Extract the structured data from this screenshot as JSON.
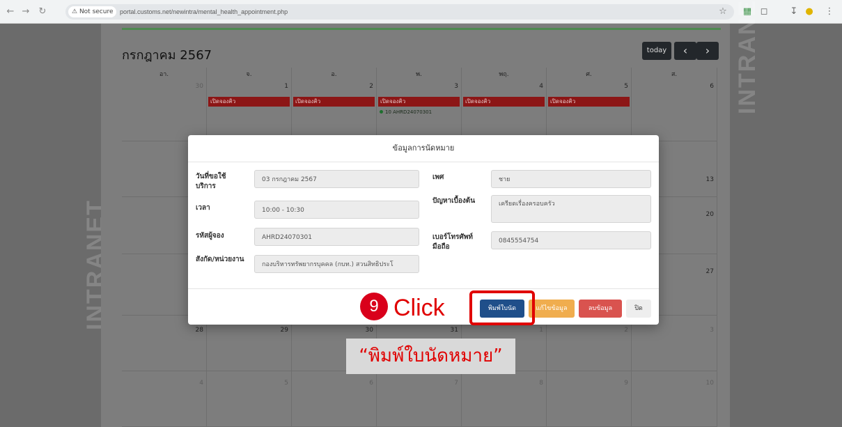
{
  "browser": {
    "security_label": "Not secure",
    "url": "portal.customs.net/newintra/mental_health_appointment.php"
  },
  "calendar": {
    "month_title": "กรกฎาคม 2567",
    "today_label": "today",
    "prev_label": "‹",
    "next_label": "›",
    "weekdays": [
      "อา.",
      "จ.",
      "อ.",
      "พ.",
      "พฤ.",
      "ศ.",
      "ส."
    ],
    "week1_days": [
      "30",
      "1",
      "2",
      "3",
      "4",
      "5",
      "6"
    ],
    "event_label": "เปิดจองคิว",
    "booked_event": "10 AHRD24070301",
    "right_days": [
      "13",
      "20",
      "27"
    ],
    "week5_days": [
      "28",
      "29",
      "30",
      "31",
      "1",
      "2",
      "3"
    ],
    "week6_days": [
      "4",
      "5",
      "6",
      "7",
      "8",
      "9",
      "10"
    ],
    "watermark": "INTRANET"
  },
  "modal": {
    "title": "ข้อมูลการนัดหมาย",
    "fields": {
      "date_label": "วันที่ขอใช้บริการ",
      "date_value": "03 กรกฎาคม 2567",
      "time_label": "เวลา",
      "time_value": "10:00 - 10:30",
      "booking_label": "รหัสผู้จอง",
      "booking_value": "AHRD24070301",
      "dept_label": "สังกัด/หน่วยงาน",
      "dept_value": "กองบริหารทรัพยากรบุคคล (กบท.) สวนสิทธิประโ",
      "gender_label": "เพศ",
      "gender_value": "ชาย",
      "problem_label": "ปัญหาเบื้องต้น",
      "problem_value": "เครียดเรื่องครอบครัว",
      "phone_label": "เบอร์โทรศัพท์มือถือ",
      "phone_value": "0845554754"
    },
    "buttons": {
      "print": "พิมพ์ใบนัด",
      "edit": "แก้ไขข้อมูล",
      "delete": "ลบข้อมูล",
      "close": "ปิด"
    }
  },
  "annotation": {
    "step_number": "9",
    "action": "Click",
    "caption": "“พิมพ์ใบนัดหมาย”"
  },
  "colors": {
    "event_red": "#8c1616",
    "print_blue": "#1f4f8a",
    "edit_orange": "#f0ad4e",
    "delete_red": "#d9534f",
    "highlight_red": "#e00000"
  }
}
